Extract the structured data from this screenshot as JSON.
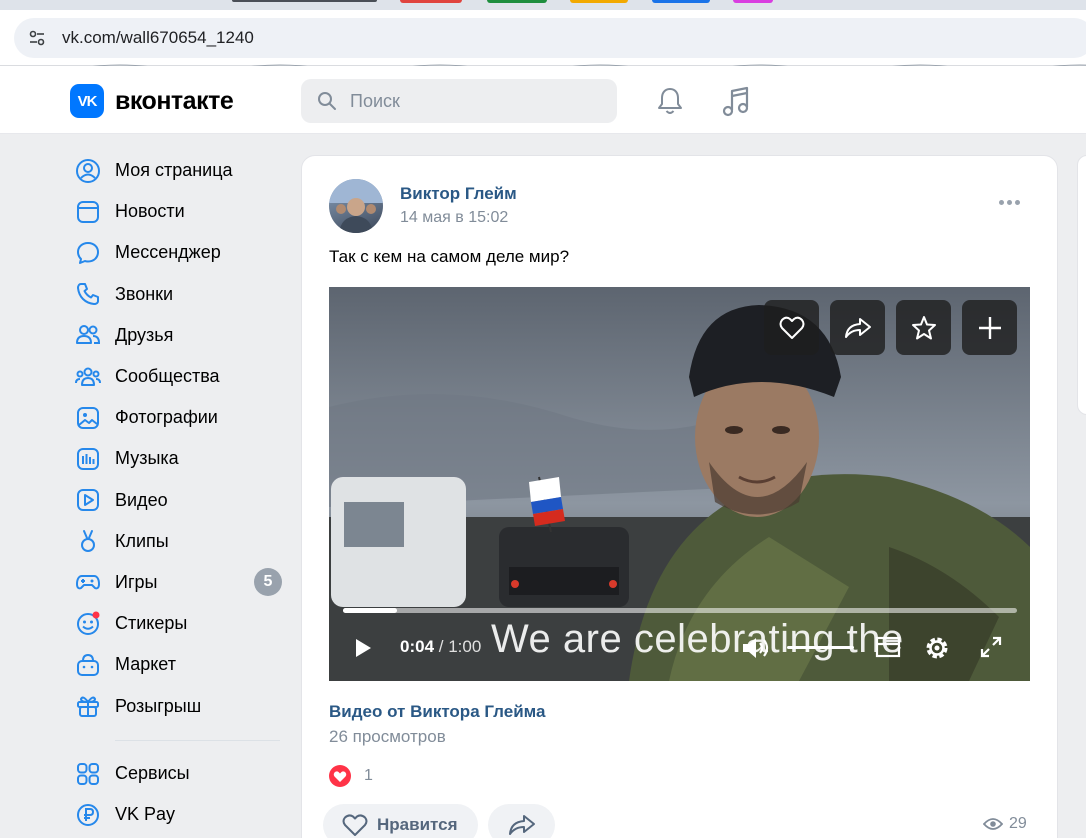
{
  "browser": {
    "url": "vk.com/wall670654_1240"
  },
  "header": {
    "logo_mark": "VK",
    "logo_text": "вконтакте",
    "search_placeholder": "Поиск"
  },
  "nav": {
    "items": [
      {
        "label": "Моя страница",
        "icon": "user-circle-icon"
      },
      {
        "label": "Новости",
        "icon": "news-icon"
      },
      {
        "label": "Мессенджер",
        "icon": "message-icon"
      },
      {
        "label": "Звонки",
        "icon": "phone-icon"
      },
      {
        "label": "Друзья",
        "icon": "friends-icon"
      },
      {
        "label": "Сообщества",
        "icon": "communities-icon"
      },
      {
        "label": "Фотографии",
        "icon": "photo-icon"
      },
      {
        "label": "Музыка",
        "icon": "music-icon"
      },
      {
        "label": "Видео",
        "icon": "video-icon"
      },
      {
        "label": "Клипы",
        "icon": "clips-icon"
      },
      {
        "label": "Игры",
        "icon": "gamepad-icon",
        "badge": "5"
      },
      {
        "label": "Стикеры",
        "icon": "sticker-icon"
      },
      {
        "label": "Маркет",
        "icon": "market-icon"
      },
      {
        "label": "Розыгрыш",
        "icon": "gift-icon"
      }
    ],
    "secondary": [
      {
        "label": "Сервисы",
        "icon": "services-icon"
      },
      {
        "label": "VK Pay",
        "icon": "vkpay-icon"
      }
    ]
  },
  "post": {
    "author": "Виктор Глейм",
    "date": "14 мая в 15:02",
    "text": "Так с кем на самом деле мир?",
    "video": {
      "current_time": "0:04",
      "duration": "/ 1:00",
      "subtitle": "We are celebrating the",
      "progress": 0.08,
      "volume": 1.0
    },
    "video_title": "Видео от Виктора Глейма",
    "views_text": "26 просмотров",
    "reactions_count": "1",
    "like_label": "Нравится",
    "view_count": "29"
  },
  "colors": {
    "accent": "#0077ff",
    "link": "#2a5885",
    "muted": "#818c99",
    "reaction": "#ff3347"
  }
}
